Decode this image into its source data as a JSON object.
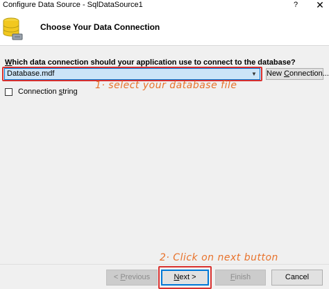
{
  "window": {
    "title": "Configure Data Source - SqlDataSource1",
    "help_glyph": "?",
    "close_glyph": "✕"
  },
  "header": {
    "heading": "Choose Your Data Connection",
    "icon": "database-icon"
  },
  "question": {
    "before_mnemonic": "",
    "mnemonic": "W",
    "after_mnemonic": "hich data connection should your application use to connect to the database?"
  },
  "connection_combo": {
    "selected": "Database.mdf",
    "arrow": "▼"
  },
  "new_connection_button": {
    "before_mnemonic": "New ",
    "mnemonic": "C",
    "after_mnemonic": "onnection..."
  },
  "connection_string": {
    "checked": false,
    "label_before": "Connection ",
    "mnemonic": "s",
    "label_after": "tring"
  },
  "annotations": {
    "step1": "1· select your database file",
    "step2": "2· Click on next button"
  },
  "buttons": {
    "previous": {
      "before": "< ",
      "mnemonic": "P",
      "after": "revious",
      "enabled": false
    },
    "next": {
      "before": "",
      "mnemonic": "N",
      "after": "ext >",
      "enabled": true
    },
    "finish": {
      "before": "",
      "mnemonic": "F",
      "after": "inish",
      "enabled": false
    },
    "cancel": {
      "label": "Cancel",
      "enabled": true
    }
  },
  "colors": {
    "highlight_red": "#d9312f",
    "annotation_orange": "#e8722b",
    "focus_blue": "#0078d7",
    "selection_bg": "#cce4f7"
  }
}
